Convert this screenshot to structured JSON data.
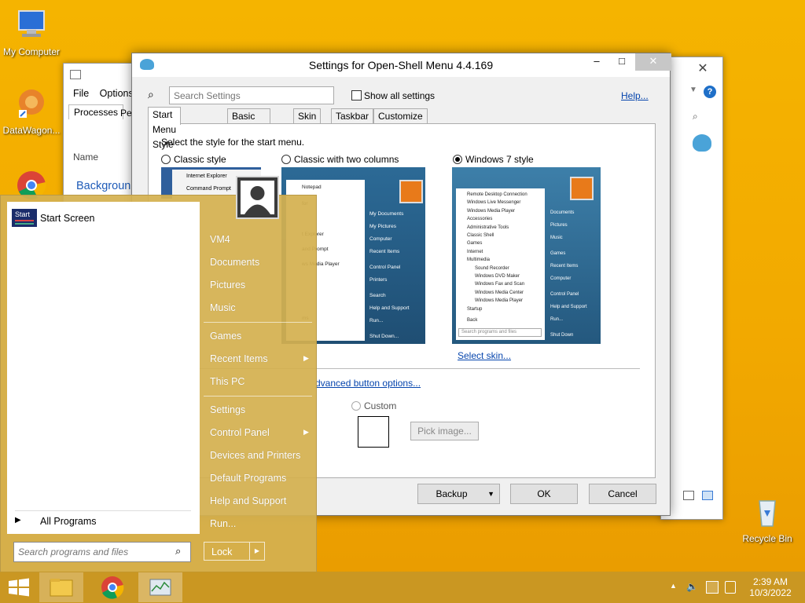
{
  "desktop": {
    "icons": [
      {
        "name": "my-computer",
        "label": "My Computer"
      },
      {
        "name": "datawagon",
        "label": "DataWagon..."
      },
      {
        "name": "recycle-bin",
        "label": "Recycle Bin"
      }
    ]
  },
  "task_manager": {
    "menu": [
      "File",
      "Options"
    ],
    "tabs": [
      "Processes",
      "Pe"
    ],
    "column": "Name",
    "group": "Backgroun"
  },
  "settings": {
    "title": "Settings for Open-Shell Menu 4.4.169",
    "search_placeholder": "Search Settings",
    "show_all": "Show all settings",
    "help": "Help...",
    "tabs": [
      "Start Menu Style",
      "Basic Settings",
      "Skin",
      "Taskbar",
      "Customize Start Menu"
    ],
    "prompt": "Select the style for the start menu.",
    "styles": [
      "Classic style",
      "Classic with two columns",
      "Windows 7 style"
    ],
    "selected_style": "Windows 7 style",
    "select_skin": "Select skin...",
    "advanced": "dvanced button options...",
    "custom": "Custom",
    "pick_image": "Pick image...",
    "buttons": {
      "backup": "Backup",
      "ok": "OK",
      "cancel": "Cancel"
    },
    "preview_classic": [
      "Internet Explorer",
      "Command Prompt"
    ],
    "preview_two": {
      "left": [
        "Notepad",
        "for",
        "t Explorer",
        "and Prompt",
        "ws Media Player",
        "ms"
      ],
      "right": [
        "My Documents",
        "My Pictures",
        "Computer",
        "Recent Items",
        "Control Panel",
        "Printers",
        "Search",
        "Help and Support",
        "Run...",
        "Shut Down..."
      ]
    },
    "preview_win7": {
      "left": [
        "Remote Desktop Connection",
        "Windows Live Messenger",
        "Windows Media Player",
        "Accessories",
        "Administrative Tools",
        "Classic Shell",
        "Games",
        "Internet",
        "Multimedia",
        "Sound Recorder",
        "Windows DVD Maker",
        "Windows Fax and Scan",
        "Windows Media Center",
        "Windows Media Player",
        "Startup",
        "Back"
      ],
      "search": "Search programs and files",
      "right": [
        "Documents",
        "Pictures",
        "Music",
        "Games",
        "Recent Items",
        "Computer",
        "Control Panel",
        "Help and Support",
        "Run...",
        "Shut Down"
      ]
    }
  },
  "startmenu": {
    "pinned": "Start Screen",
    "pinned_icon_text": "Start",
    "all_programs": "All Programs",
    "search_placeholder": "Search programs and files",
    "right_items": [
      "VM4",
      "Documents",
      "Pictures",
      "Music",
      "Games",
      "Recent Items",
      "This PC",
      "Settings",
      "Control Panel",
      "Devices and Printers",
      "Default Programs",
      "Help and Support",
      "Run..."
    ],
    "lock": "Lock"
  },
  "taskbar": {
    "time": "2:39 AM",
    "date": "10/3/2022"
  }
}
